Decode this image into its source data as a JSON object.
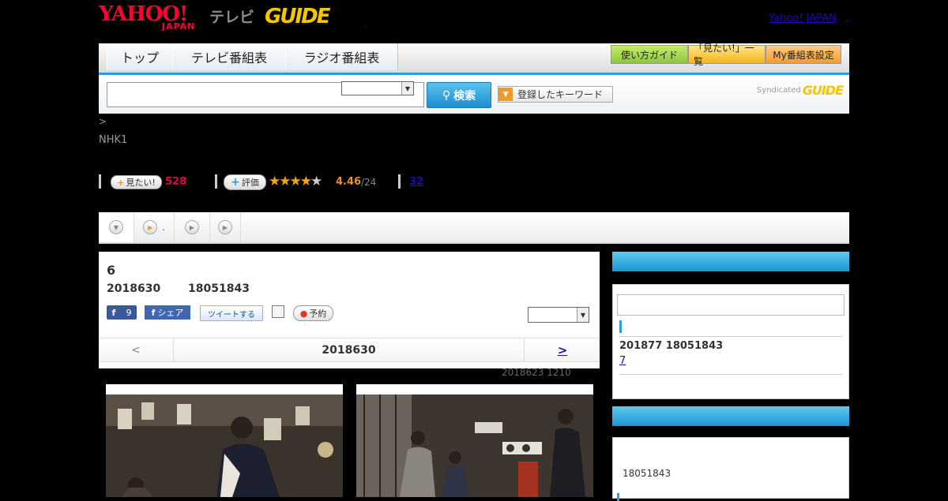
{
  "header": {
    "logo_yahoo": "YAHOO!",
    "logo_japan": "JAPAN",
    "logo_tv": "テレビ",
    "logo_gguide": "GUIDE",
    "yahoo_japan_link": "Yahoo! JAPAN",
    "comma": ",",
    "dot": ","
  },
  "nav": {
    "tabs": [
      {
        "label": "トップ"
      },
      {
        "label": "テレビ番組表"
      },
      {
        "label": "ラジオ番組表"
      }
    ],
    "guide": "使い方ガイド",
    "mitai_list": "「見たい!」一覧",
    "my_schedule": "My番組表設定"
  },
  "search": {
    "input_value": "",
    "select_value": "",
    "button": "検索",
    "keyword_button": "登録したキーワード",
    "syndicated": "Syndicated",
    "syndicated_logo": "GUIDE"
  },
  "breadcrumb": ">",
  "channel": "NHK1",
  "stats": {
    "mitai_label": "見たい!",
    "mitai_count": "528",
    "hyoka_label": "評価",
    "stars_full": "★★★★",
    "star_empty": "★",
    "rating": "4.46",
    "rating_count": "/24",
    "comments": "32"
  },
  "subnav": {
    "items": [
      {
        "label": ""
      },
      {
        "label": "."
      },
      {
        "label": ""
      },
      {
        "label": ""
      }
    ]
  },
  "episode": {
    "number": "6",
    "date": "2018630",
    "time": "18051843",
    "fb_count": "9",
    "share": "シェア",
    "tweet": "ツイートする",
    "reserve": "予約",
    "select_value": ""
  },
  "pager": {
    "prev": "<",
    "date": "2018630",
    "next": ">"
  },
  "updated": "2018623  1210",
  "sidebar": {
    "box1": {
      "date": "201877  18051843",
      "link": "7"
    },
    "box2": {
      "time": "18051843"
    }
  }
}
